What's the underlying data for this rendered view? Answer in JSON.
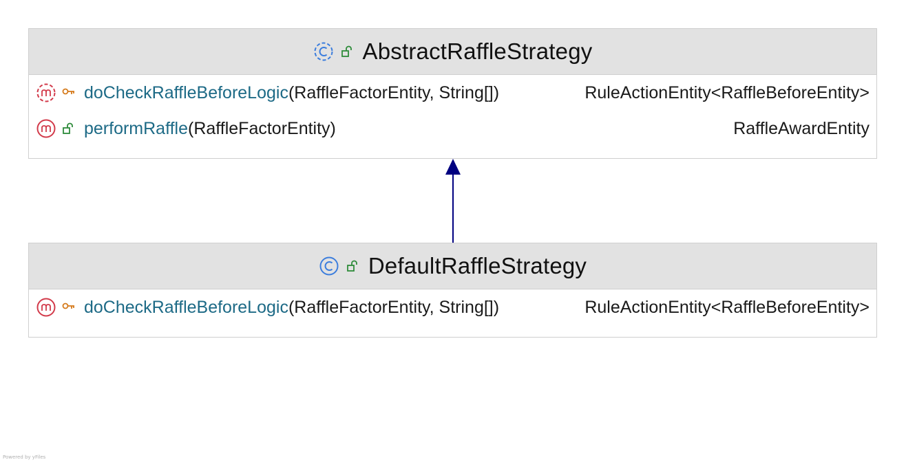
{
  "classes": [
    {
      "name": "AbstractRaffleStrategy",
      "kind_icon": "abstract-class-icon",
      "visibility_icon": "public-lock-icon",
      "members": [
        {
          "kind_icon": "method-icon-dashed",
          "visibility_icon": "protected-key-icon",
          "name": "doCheckRaffleBeforeLogic",
          "params": "(RaffleFactorEntity, String[])",
          "return_type": "RuleActionEntity",
          "return_generic": "<RaffleBeforeEntity>"
        },
        {
          "kind_icon": "method-icon",
          "visibility_icon": "public-lock-icon",
          "name": "performRaffle",
          "params": "(RaffleFactorEntity)",
          "return_type": "RaffleAwardEntity",
          "return_generic": ""
        }
      ]
    },
    {
      "name": "DefaultRaffleStrategy",
      "kind_icon": "class-icon",
      "visibility_icon": "public-lock-icon",
      "members": [
        {
          "kind_icon": "method-icon",
          "visibility_icon": "protected-key-icon",
          "name": "doCheckRaffleBeforeLogic",
          "params": "(RaffleFactorEntity, String[])",
          "return_type": "RuleActionEntity",
          "return_generic": "<RaffleBeforeEntity>"
        }
      ]
    }
  ],
  "relations": [
    {
      "type": "inheritance",
      "from": "DefaultRaffleStrategy",
      "to": "AbstractRaffleStrategy",
      "color": "#000080"
    }
  ],
  "colors": {
    "class_icon": "#3b7ddd",
    "method_icon": "#d23a4a",
    "public_icon": "#2e8b3a",
    "protected_icon": "#d57a1b",
    "method_name": "#1d6a86"
  },
  "footer": "Powered by yFiles"
}
